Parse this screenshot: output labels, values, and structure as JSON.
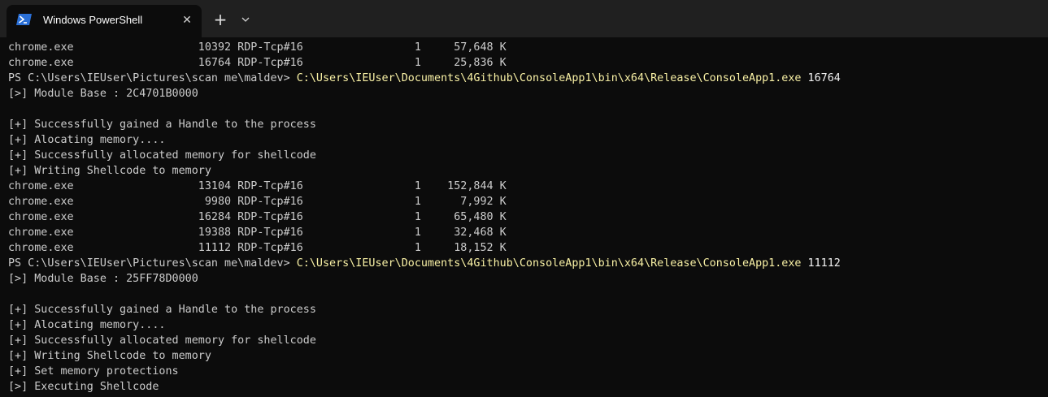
{
  "window": {
    "tab_title": "Windows PowerShell",
    "tab_icon": "powershell-icon",
    "close_icon": "close-icon",
    "new_tab_icon": "plus-icon",
    "dropdown_icon": "chevron-down-icon"
  },
  "colors": {
    "background": "#0c0c0c",
    "titlebar": "#202020",
    "text": "#cccccc",
    "command": "#f9f1a5",
    "argument": "#f2f2f2"
  },
  "console": {
    "lines": [
      {
        "text": "chrome.exe                   10392 RDP-Tcp#16                 1     57,648 K"
      },
      {
        "text": "chrome.exe                   16764 RDP-Tcp#16                 1     25,836 K"
      },
      {
        "prompt": "PS C:\\Users\\IEUser\\Pictures\\scan me\\maldev> ",
        "command": "C:\\Users\\IEUser\\Documents\\4Github\\ConsoleApp1\\bin\\x64\\Release\\ConsoleApp1.exe",
        "argument": " 16764"
      },
      {
        "text": "[>] Module Base : 2C4701B0000"
      },
      {
        "text": ""
      },
      {
        "text": "[+] Successfully gained a Handle to the process"
      },
      {
        "text": "[+] Alocating memory...."
      },
      {
        "text": "[+] Successfully allocated memory for shellcode"
      },
      {
        "text": "[+] Writing Shellcode to memory"
      },
      {
        "text": "chrome.exe                   13104 RDP-Tcp#16                 1    152,844 K"
      },
      {
        "text": "chrome.exe                    9980 RDP-Tcp#16                 1      7,992 K"
      },
      {
        "text": "chrome.exe                   16284 RDP-Tcp#16                 1     65,480 K"
      },
      {
        "text": "chrome.exe                   19388 RDP-Tcp#16                 1     32,468 K"
      },
      {
        "text": "chrome.exe                   11112 RDP-Tcp#16                 1     18,152 K"
      },
      {
        "prompt": "PS C:\\Users\\IEUser\\Pictures\\scan me\\maldev> ",
        "command": "C:\\Users\\IEUser\\Documents\\4Github\\ConsoleApp1\\bin\\x64\\Release\\ConsoleApp1.exe",
        "argument": " 11112"
      },
      {
        "text": "[>] Module Base : 25FF78D0000"
      },
      {
        "text": ""
      },
      {
        "text": "[+] Successfully gained a Handle to the process"
      },
      {
        "text": "[+] Alocating memory...."
      },
      {
        "text": "[+] Successfully allocated memory for shellcode"
      },
      {
        "text": "[+] Writing Shellcode to memory"
      },
      {
        "text": "[+] Set memory protections"
      },
      {
        "text": "[>] Executing Shellcode"
      }
    ]
  }
}
